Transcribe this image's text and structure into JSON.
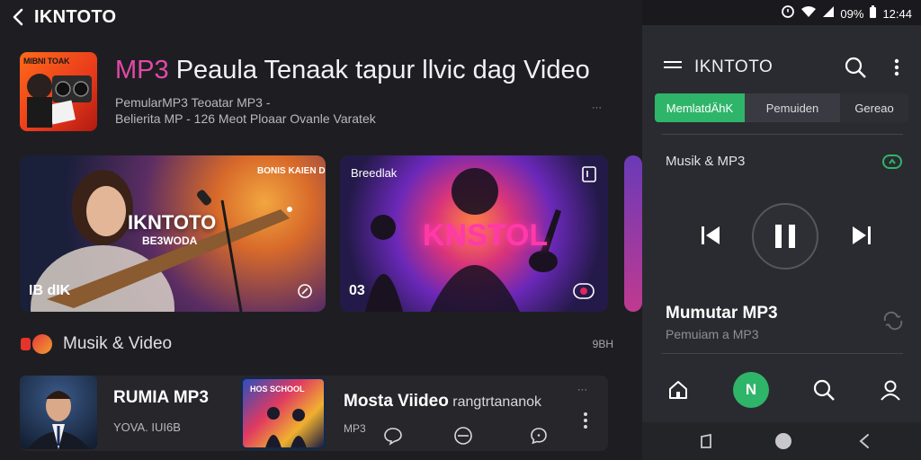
{
  "app": {
    "title": "IKNTOTO"
  },
  "hero": {
    "album_label": "MIBNI TOAK",
    "title_accent": "MP3",
    "title_rest": " Peaula Tenaak tapur llvic dag Video",
    "sub1": "PemularMP3  Teoatar MP3 -",
    "sub2": "Belierita MP - 126 Meot Ploaar Ovanle Varatek",
    "mini": "···"
  },
  "cards": [
    {
      "big": "IKNTOTO",
      "sub": "BE3WODA",
      "badge": "BONIS KAIEN DHORADOA",
      "corner": "IB dIK"
    },
    {
      "big": "KNSTOL",
      "tag": "Breedlak",
      "corner": "03"
    }
  ],
  "section": {
    "title": "Musik & Video",
    "right": "9BH"
  },
  "rows": {
    "item1": {
      "title": "RUMIA MP3",
      "sub": "YOVA. IUI6B"
    },
    "item2": {
      "thumb_label": "HOS SCHOOL",
      "title": "Mosta Viideo",
      "title_ext": " rangtrtananok",
      "sub": "MP3"
    },
    "more": "···"
  },
  "right": {
    "status_time": "12:44",
    "status_battery": "09%",
    "app_title": "IKNTOTO",
    "tabs": [
      "MemlatdÄhK",
      "Pemuiden",
      "Gereao"
    ],
    "now_playing_label": "Musik & MP3",
    "track_title": "Mumutar MP3",
    "track_sub": "Pemuiam a MP3",
    "nav_center": "N"
  },
  "colors": {
    "accent_green": "#2fb56a",
    "accent_pink": "#e24aa8",
    "bg_dark": "#1e1e22",
    "panel": "#2a2b30"
  }
}
